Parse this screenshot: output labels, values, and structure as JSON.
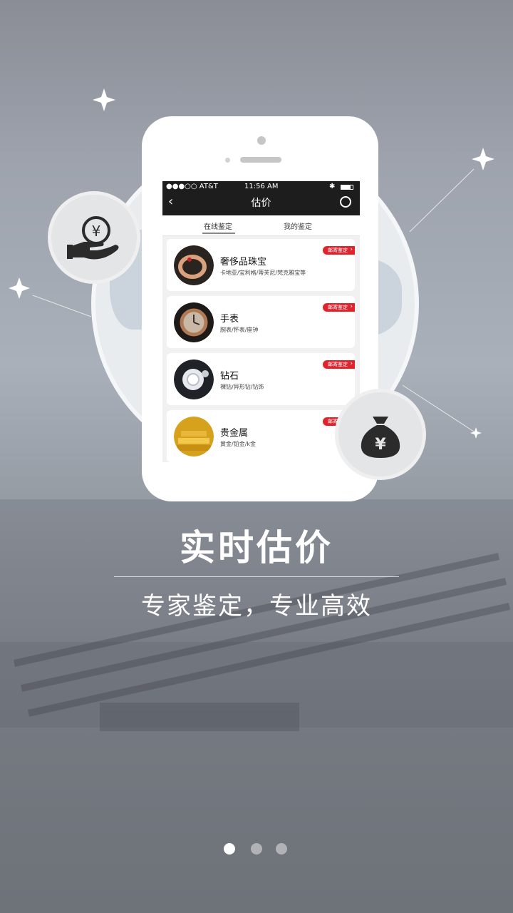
{
  "intro": {
    "headline": "实时估价",
    "subline": "专家鉴定，专业高效",
    "page_dots": [
      true,
      false,
      false
    ]
  },
  "status_bar": {
    "carrier": "●●●○○ AT&T",
    "time": "11:56 AM"
  },
  "nav": {
    "title": "估价"
  },
  "tabs": [
    {
      "label": "在线鉴定",
      "active": true
    },
    {
      "label": "我的鉴定",
      "active": false
    }
  ],
  "categories": [
    {
      "title": "奢侈品珠宝",
      "subtitle": "卡地亚/宝利格/蒂芙尼/梵克雅宝等",
      "badge": "邮寄鉴定",
      "icon": "ring-icon"
    },
    {
      "title": "手表",
      "subtitle": "腕表/怀表/座钟",
      "badge": "邮寄鉴定",
      "icon": "watch-icon"
    },
    {
      "title": "钻石",
      "subtitle": "裸钻/异形钻/钻饰",
      "badge": "邮寄鉴定",
      "icon": "diamond-icon"
    },
    {
      "title": "贵金属",
      "subtitle": "黄金/铂金/k金",
      "badge": "邮寄鉴定",
      "icon": "gold-bar-icon"
    }
  ],
  "colors": {
    "badge": "#e0232d",
    "navbar": "#1d1d1d"
  }
}
